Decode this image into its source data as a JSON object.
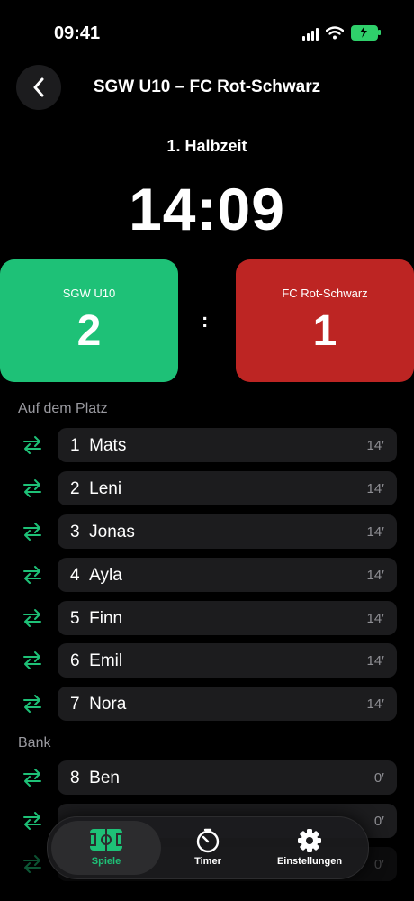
{
  "status": {
    "time": "09:41"
  },
  "header": {
    "title": "SGW U10 – FC Rot-Schwarz"
  },
  "match": {
    "period": "1. Halbzeit",
    "clock": "14:09",
    "home": {
      "name": "SGW U10",
      "score": "2",
      "color": "#1ec177"
    },
    "away": {
      "name": "FC Rot-Schwarz",
      "score": "1",
      "color": "#bd2523"
    },
    "separator": ":"
  },
  "on_field": {
    "label": "Auf dem Platz",
    "players": [
      {
        "num": "1",
        "name": "Mats",
        "minutes": "14′"
      },
      {
        "num": "2",
        "name": "Leni",
        "minutes": "14′"
      },
      {
        "num": "3",
        "name": "Jonas",
        "minutes": "14′"
      },
      {
        "num": "4",
        "name": "Ayla",
        "minutes": "14′"
      },
      {
        "num": "5",
        "name": "Finn",
        "minutes": "14′"
      },
      {
        "num": "6",
        "name": "Emil",
        "minutes": "14′"
      },
      {
        "num": "7",
        "name": "Nora",
        "minutes": "14′"
      }
    ]
  },
  "bench": {
    "label": "Bank",
    "players": [
      {
        "num": "8",
        "name": "Ben",
        "minutes": "0′"
      },
      {
        "num": "",
        "name": "",
        "minutes": "0′"
      },
      {
        "num": "",
        "name": "",
        "minutes": "0′"
      }
    ]
  },
  "tabbar": {
    "tabs": [
      {
        "label": "Spiele",
        "icon": "soccer-field-icon",
        "active": true
      },
      {
        "label": "Timer",
        "icon": "stopwatch-icon",
        "active": false
      },
      {
        "label": "Einstellungen",
        "icon": "gear-icon",
        "active": false
      }
    ]
  },
  "accent": "#1ec177"
}
